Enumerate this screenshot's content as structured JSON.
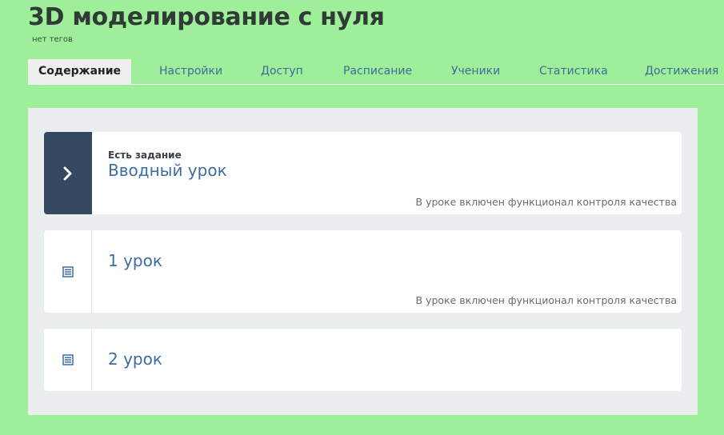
{
  "course": {
    "title": "3D моделирование с нуля",
    "tags": "нет тегов"
  },
  "tabs": [
    {
      "label": "Содержание",
      "active": true
    },
    {
      "label": "Настройки",
      "active": false
    },
    {
      "label": "Доступ",
      "active": false
    },
    {
      "label": "Расписание",
      "active": false
    },
    {
      "label": "Ученики",
      "active": false
    },
    {
      "label": "Статистика",
      "active": false
    },
    {
      "label": "Достижения",
      "active": false
    }
  ],
  "lessons": [
    {
      "note": "Есть задание",
      "title": "Вводный урок",
      "quality_control": "В уроке включен функционал контроля качества",
      "icon": "chevron-right-icon"
    },
    {
      "title": "1 урок",
      "quality_control": "В уроке включен функционал контроля качества",
      "icon": "lesson-list-icon"
    },
    {
      "title": "2 урок",
      "icon": "lesson-list-icon"
    }
  ],
  "colors": {
    "page_background": "#9eee9a",
    "panel_background": "#ebeeee",
    "active_lesson_sidebar": "#344860",
    "link_blue": "#3d6da0"
  }
}
